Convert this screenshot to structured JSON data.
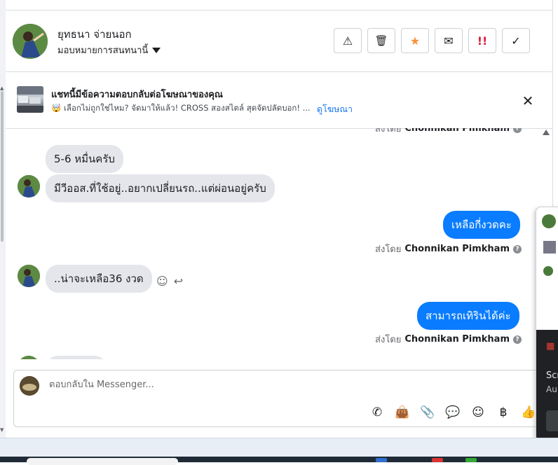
{
  "header": {
    "contact_name": "ยุทธนา จ่ายนอก",
    "assign_label": "มอบหมายการสนทนานี้",
    "actions": [
      {
        "name": "spam-icon",
        "glyph": "⚠"
      },
      {
        "name": "trash-icon",
        "glyph": "🗑"
      },
      {
        "name": "star-icon",
        "glyph": "★"
      },
      {
        "name": "envelope-icon",
        "glyph": "✉"
      },
      {
        "name": "important-icon",
        "glyph": "!!"
      },
      {
        "name": "check-icon",
        "glyph": "✓"
      }
    ]
  },
  "ad_banner": {
    "title": "แชทนี้มีข้อความตอบกลับต่อโฆษณาของคุณ",
    "preview": "🤯 เลือกไม่ถูกใช่ไหม? จัดมาให้แล้ว! CROSS สองสไตล์ สุดจัดปลัดบอก! ...",
    "view_ad_label": "ดูโฆษณา",
    "close_glyph": "✕"
  },
  "messages": {
    "sent_prefix": "ส่งโดย",
    "sender_name": "Chonnikan Pimkham",
    "help_glyph": "?",
    "items": [
      {
        "dir": "in",
        "text": "5-6 หมื่นครับ"
      },
      {
        "dir": "in",
        "text": "มีวีออส.ที่ใช้อยู่..อยากเปลี่ยนรถ..แต่ผ่อนอยู่ครับ"
      },
      {
        "dir": "out",
        "text": "เหลือกี่งวดคะ"
      },
      {
        "dir": "in",
        "text": "..น่าจะเหลือ36 งวด"
      },
      {
        "dir": "out",
        "text": "สามารถเทิรินได้ค่ะ"
      }
    ]
  },
  "composer": {
    "placeholder": "ตอบกลับใน Messenger...",
    "tools": [
      {
        "name": "call-icon",
        "glyph": "✆"
      },
      {
        "name": "shopping-bag-icon",
        "glyph": "👜"
      },
      {
        "name": "attachment-icon",
        "glyph": "📎"
      },
      {
        "name": "saved-reply-icon",
        "glyph": "💬"
      },
      {
        "name": "emoji-icon",
        "glyph": "☺"
      },
      {
        "name": "baht-icon",
        "glyph": "฿"
      },
      {
        "name": "like-icon",
        "glyph": "👍"
      }
    ]
  },
  "popup": {
    "line1": "Scr",
    "line2": "Au"
  },
  "colors": {
    "outgoing_bubble": "#0a7cff",
    "incoming_bubble": "#e4e6eb",
    "link": "#1877f2",
    "star": "#f7923a",
    "important": "#e41e3f"
  }
}
